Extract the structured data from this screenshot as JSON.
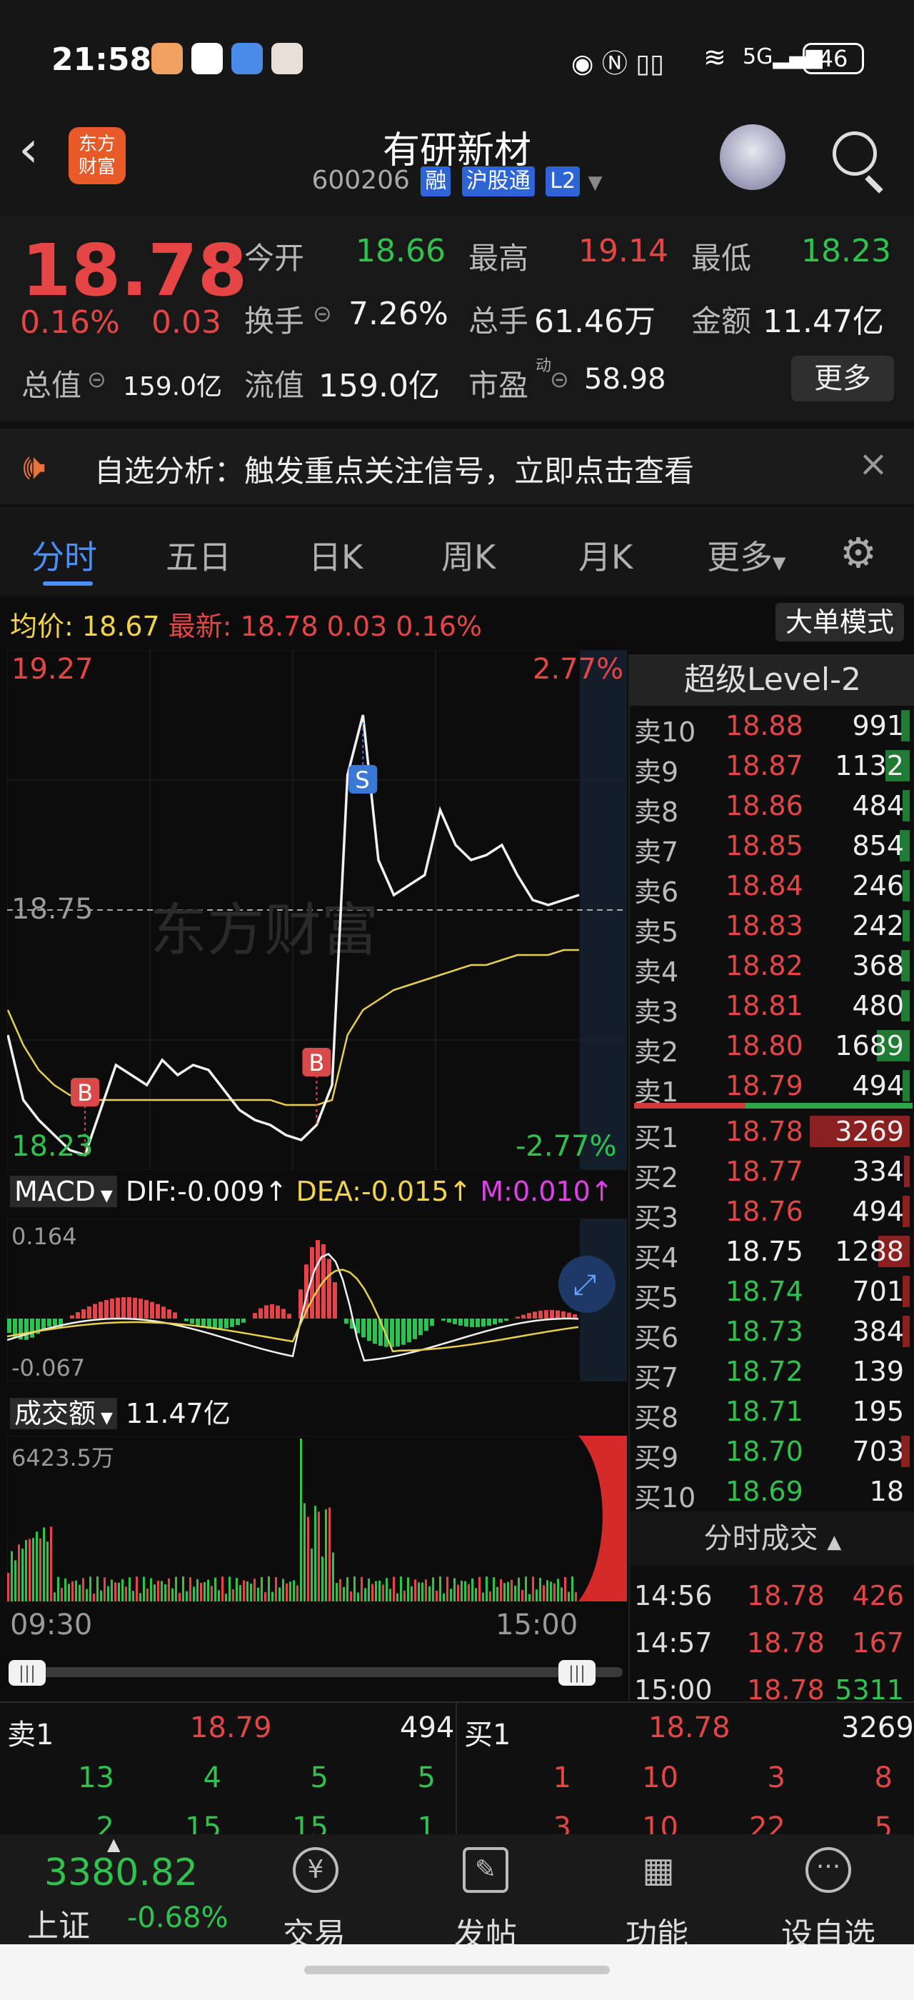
{
  "status_bar": {
    "time": "21:58",
    "battery": "46"
  },
  "header": {
    "stock_name": "有研新材",
    "code": "600206",
    "tags": [
      "融",
      "沪股通",
      "L2"
    ]
  },
  "quote": {
    "price": "18.78",
    "change_pct": "0.16%",
    "change": "0.03",
    "open_label": "今开",
    "open": "18.66",
    "high_label": "最高",
    "high": "19.14",
    "low_label": "最低",
    "low": "18.23",
    "turnover_label": "换手",
    "turnover": "7.26%",
    "volume_label": "总手",
    "volume": "61.46万",
    "amount_label": "金额",
    "amount": "11.47亿",
    "mktcap_label": "总值",
    "mktcap": "159.0亿",
    "float_label": "流值",
    "float": "159.0亿",
    "pe_label": "市盈",
    "pe_sup": "动",
    "pe": "58.98",
    "more_button": "更多"
  },
  "notice": {
    "text": "自选分析：触发重点关注信号，立即点击查看"
  },
  "tabs": [
    {
      "label": "分时",
      "active": true
    },
    {
      "label": "五日"
    },
    {
      "label": "日K"
    },
    {
      "label": "周K"
    },
    {
      "label": "月K"
    },
    {
      "label": "更多"
    }
  ],
  "chart_info": {
    "avg_label": "均价:",
    "avg": "18.67",
    "latest_label": "最新:",
    "latest": "18.78",
    "latest_change": "0.03",
    "latest_pct": "0.16%",
    "big_order_button": "大单模式",
    "top_price": "19.27",
    "top_pct": "2.77%",
    "mid_price": "18.75",
    "bottom_price": "18.23",
    "bottom_pct": "-2.77%",
    "time_start": "09:30",
    "time_end": "15:00",
    "macd_label": "MACD",
    "dif": "DIF:-0.009↑",
    "dea": "DEA:-0.015↑",
    "m": "M:0.010↑",
    "macd_top": "0.164",
    "macd_bottom": "-0.067",
    "vol_label": "成交额",
    "vol_total": "11.47亿",
    "vol_max": "6423.5万",
    "b_marker": "B",
    "s_marker": "S"
  },
  "chart_data": {
    "type": "line",
    "ylim": [
      18.23,
      19.27
    ],
    "prev_close": 18.75,
    "price": [
      18.5,
      18.37,
      18.33,
      18.3,
      18.27,
      18.26,
      18.35,
      18.44,
      18.42,
      18.4,
      18.45,
      18.42,
      18.44,
      18.43,
      18.39,
      18.35,
      18.33,
      18.32,
      18.3,
      18.29,
      18.32,
      18.4,
      19.02,
      19.14,
      18.85,
      18.78,
      18.8,
      18.82,
      18.95,
      18.88,
      18.85,
      18.86,
      18.88,
      18.82,
      18.77,
      18.76,
      18.77,
      18.78
    ],
    "avg": [
      18.55,
      18.48,
      18.43,
      18.4,
      18.38,
      18.37,
      18.37,
      18.37,
      18.37,
      18.37,
      18.37,
      18.37,
      18.37,
      18.37,
      18.37,
      18.37,
      18.37,
      18.37,
      18.36,
      18.36,
      18.36,
      18.37,
      18.5,
      18.55,
      18.57,
      18.59,
      18.6,
      18.61,
      18.62,
      18.63,
      18.64,
      18.64,
      18.65,
      18.66,
      18.66,
      18.66,
      18.67,
      18.67
    ]
  },
  "level2": {
    "title": "超级Level-2",
    "asks": [
      {
        "label": "卖10",
        "price": "18.88",
        "vol": "991"
      },
      {
        "label": "卖9",
        "price": "18.87",
        "vol": "1132"
      },
      {
        "label": "卖8",
        "price": "18.86",
        "vol": "484"
      },
      {
        "label": "卖7",
        "price": "18.85",
        "vol": "854"
      },
      {
        "label": "卖6",
        "price": "18.84",
        "vol": "246"
      },
      {
        "label": "卖5",
        "price": "18.83",
        "vol": "242"
      },
      {
        "label": "卖4",
        "price": "18.82",
        "vol": "368"
      },
      {
        "label": "卖3",
        "price": "18.81",
        "vol": "480"
      },
      {
        "label": "卖2",
        "price": "18.80",
        "vol": "1689"
      },
      {
        "label": "卖1",
        "price": "18.79",
        "vol": "494"
      }
    ],
    "bids": [
      {
        "label": "买1",
        "price": "18.78",
        "vol": "3269"
      },
      {
        "label": "买2",
        "price": "18.77",
        "vol": "334"
      },
      {
        "label": "买3",
        "price": "18.76",
        "vol": "494"
      },
      {
        "label": "买4",
        "price": "18.75",
        "vol": "1288"
      },
      {
        "label": "买5",
        "price": "18.74",
        "vol": "701"
      },
      {
        "label": "买6",
        "price": "18.73",
        "vol": "384"
      },
      {
        "label": "买7",
        "price": "18.72",
        "vol": "139"
      },
      {
        "label": "买8",
        "price": "18.71",
        "vol": "195"
      },
      {
        "label": "买9",
        "price": "18.70",
        "vol": "703"
      },
      {
        "label": "买10",
        "price": "18.69",
        "vol": "18"
      }
    ],
    "trades_title": "分时成交",
    "trades": [
      {
        "time": "14:56",
        "price": "18.78",
        "vol": "426"
      },
      {
        "time": "14:57",
        "price": "18.78",
        "vol": "167"
      },
      {
        "time": "15:00",
        "price": "18.78",
        "vol": "5311"
      }
    ]
  },
  "depth": {
    "sell_label": "卖1",
    "sell_price": "18.79",
    "sell_vol": "494",
    "buy_label": "买1",
    "buy_price": "18.78",
    "buy_vol": "3269",
    "sell_queue_1": [
      "13",
      "4",
      "5",
      "5"
    ],
    "sell_queue_2": [
      "2",
      "15",
      "15",
      "1"
    ],
    "buy_queue_1": [
      "1",
      "10",
      "3",
      "8"
    ],
    "buy_queue_2": [
      "3",
      "10",
      "22",
      "5"
    ]
  },
  "bottom_nav": {
    "index_value": "3380.82",
    "index_name": "上证",
    "index_change": "-0.68%",
    "items": [
      {
        "label": "交易",
        "icon": "yen-icon"
      },
      {
        "label": "发帖",
        "icon": "edit-icon"
      },
      {
        "label": "功能",
        "icon": "apps-icon"
      },
      {
        "label": "设自选",
        "icon": "more-icon"
      }
    ]
  },
  "colors": {
    "up": "#e64545",
    "down": "#2fc24e",
    "accent": "#2d64d6",
    "avg_line": "#f2d44a"
  }
}
